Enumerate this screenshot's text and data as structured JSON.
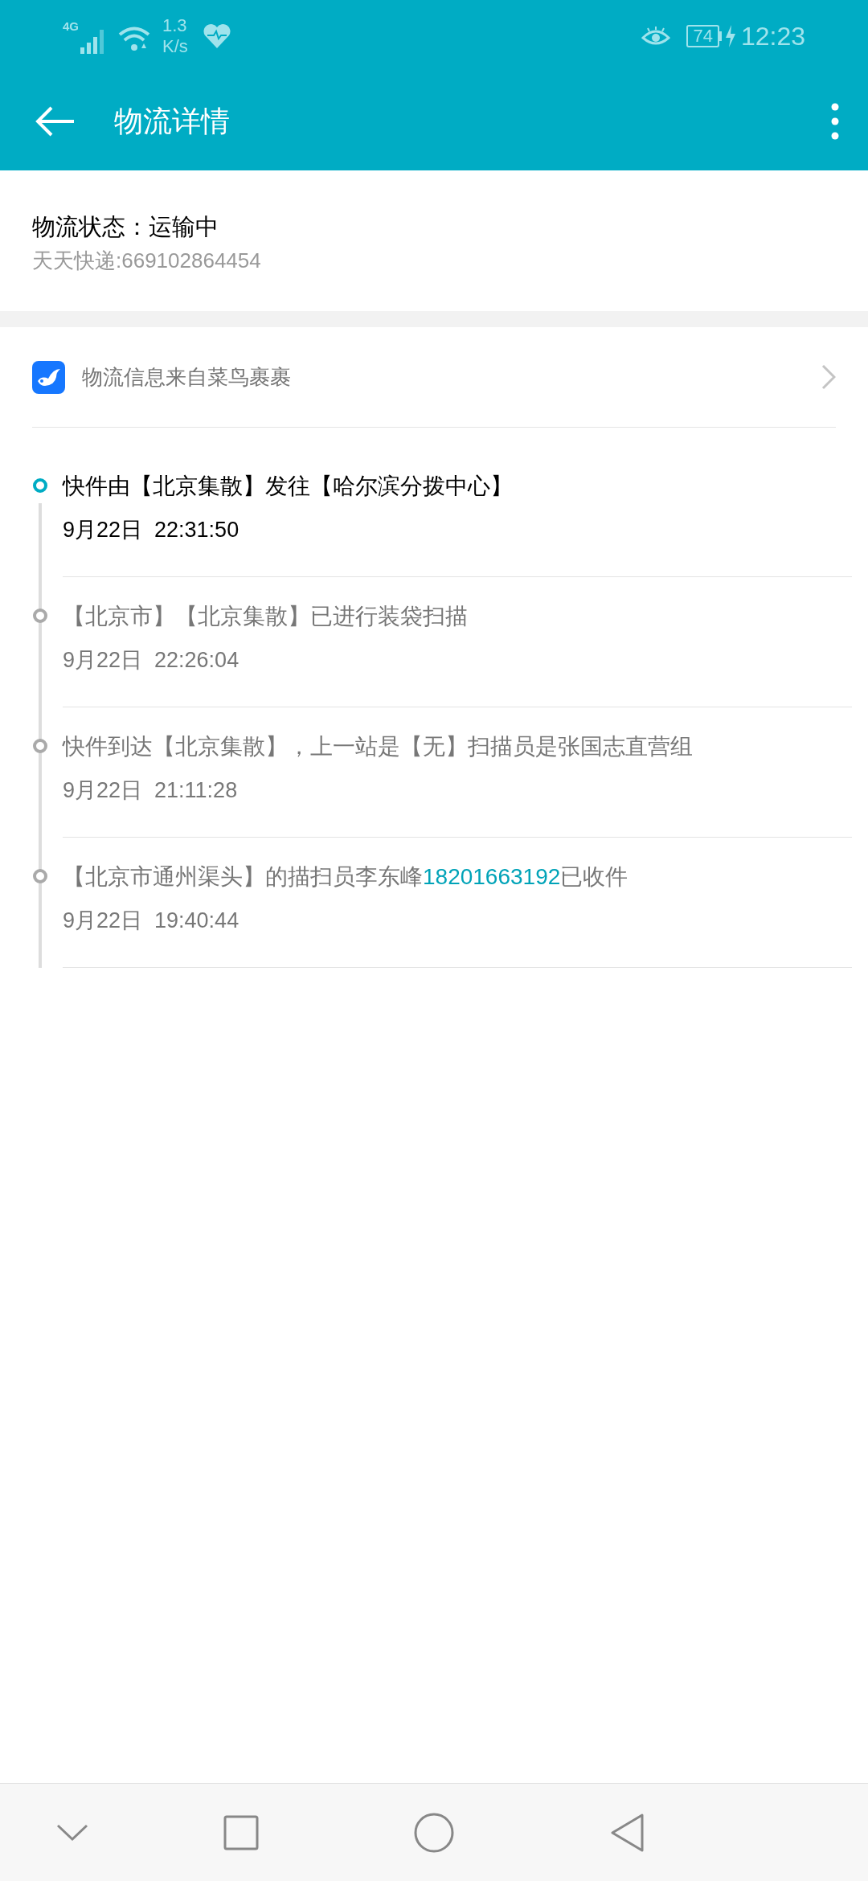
{
  "status_bar": {
    "network": "4G",
    "speed": [
      "1.3",
      "K/s"
    ],
    "battery": "74",
    "time": "12:23"
  },
  "header": {
    "title": "物流详情"
  },
  "summary": {
    "status": "物流状态：运输中",
    "tracking": "天天快递:669102864454"
  },
  "source": {
    "label": "物流信息来自菜鸟裹裹"
  },
  "timeline": [
    {
      "current": true,
      "parts": [
        {
          "kind": "plain",
          "text": "快件由【北京集散】发往【哈尔滨分拨中心】"
        }
      ],
      "time": "9月22日  22:31:50"
    },
    {
      "current": false,
      "parts": [
        {
          "kind": "plain",
          "text": "【北京市】【北京集散】已进行装袋扫描"
        }
      ],
      "time": "9月22日  22:26:04"
    },
    {
      "current": false,
      "parts": [
        {
          "kind": "plain",
          "text": "快件到达【北京集散】，上一站是【无】扫描员是张国志直营组"
        }
      ],
      "time": "9月22日  21:11:28"
    },
    {
      "current": false,
      "parts": [
        {
          "kind": "plain",
          "text": "【北京市通州渠头】的描扫员李东峰"
        },
        {
          "kind": "phone",
          "text": "18201663192"
        },
        {
          "kind": "plain",
          "text": "已收件"
        }
      ],
      "time": "9月22日  19:40:44"
    }
  ]
}
